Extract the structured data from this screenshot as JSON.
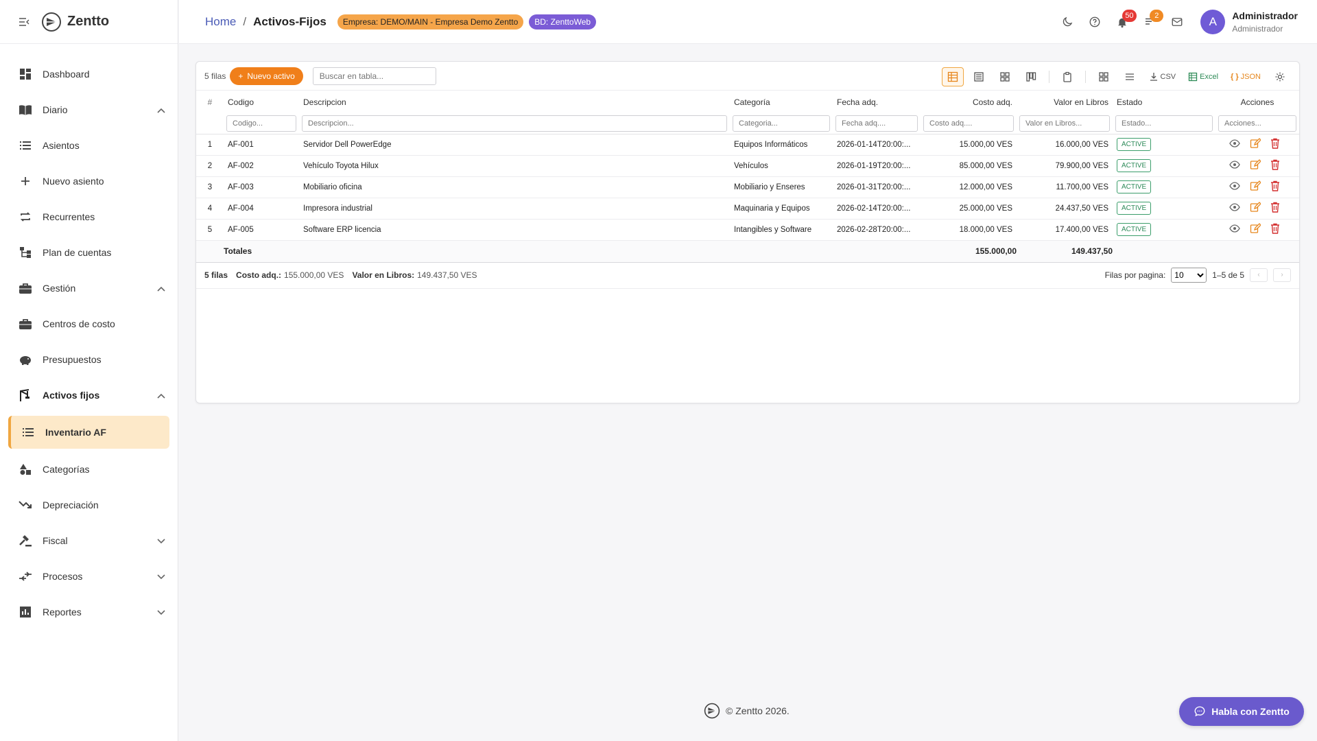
{
  "brand": {
    "name": "Zentto"
  },
  "sidebar": {
    "items": [
      {
        "label": "Dashboard",
        "icon": "dashboard-icon"
      },
      {
        "label": "Diario",
        "icon": "book-icon",
        "chevron": "up"
      },
      {
        "label": "Asientos",
        "icon": "list-icon"
      },
      {
        "label": "Nuevo asiento",
        "icon": "plus-icon"
      },
      {
        "label": "Recurrentes",
        "icon": "repeat-icon"
      },
      {
        "label": "Plan de cuentas",
        "icon": "tree-icon"
      },
      {
        "label": "Gestión",
        "icon": "briefcase-icon",
        "chevron": "up"
      },
      {
        "label": "Centros de costo",
        "icon": "briefcase-icon"
      },
      {
        "label": "Presupuestos",
        "icon": "piggy-bank-icon"
      },
      {
        "label": "Activos fijos",
        "icon": "crane-icon",
        "chevron": "up"
      },
      {
        "label": "Inventario AF",
        "icon": "list-icon",
        "active": true
      },
      {
        "label": "Categorías",
        "icon": "shapes-icon"
      },
      {
        "label": "Depreciación",
        "icon": "trending-down-icon"
      },
      {
        "label": "Fiscal",
        "icon": "gavel-icon",
        "chevron": "down"
      },
      {
        "label": "Procesos",
        "icon": "compare-arrows-icon",
        "chevron": "down"
      },
      {
        "label": "Reportes",
        "icon": "bar-chart-icon",
        "chevron": "down"
      }
    ]
  },
  "header": {
    "breadcrumb_home": "Home",
    "breadcrumb_sep": "/",
    "breadcrumb_current": "Activos-Fijos",
    "empresa_badge": "Empresa: DEMO/MAIN - Empresa Demo Zentto",
    "bd_badge": "BD: ZenttoWeb",
    "notifications_count": "50",
    "tasks_count": "2",
    "avatar_letter": "A",
    "user_name": "Administrador",
    "user_role": "Administrador"
  },
  "toolbar": {
    "rows_label": "5 filas",
    "new_button": "Nuevo activo",
    "search_placeholder": "Buscar en tabla...",
    "csv": "CSV",
    "excel": "Excel",
    "json": "JSON"
  },
  "table": {
    "columns": [
      "#",
      "Codigo",
      "Descripcion",
      "Categoría",
      "Fecha adq.",
      "Costo adq.",
      "Valor en Libros",
      "Estado",
      "Acciones"
    ],
    "filter_placeholders": [
      "Codigo...",
      "Descripcion...",
      "Categoria...",
      "Fecha adq....",
      "Costo adq....",
      "Valor en Libros...",
      "Estado...",
      "Acciones..."
    ],
    "rows": [
      {
        "n": "1",
        "codigo": "AF-001",
        "descripcion": "Servidor Dell PowerEdge",
        "categoria": "Equipos Informáticos",
        "fecha": "2026-01-14T20:00:...",
        "costo": "15.000,00 VES",
        "valor": "16.000,00 VES",
        "estado": "ACTIVE"
      },
      {
        "n": "2",
        "codigo": "AF-002",
        "descripcion": "Vehículo Toyota Hilux",
        "categoria": "Vehículos",
        "fecha": "2026-01-19T20:00:...",
        "costo": "85.000,00 VES",
        "valor": "79.900,00 VES",
        "estado": "ACTIVE"
      },
      {
        "n": "3",
        "codigo": "AF-003",
        "descripcion": "Mobiliario oficina",
        "categoria": "Mobiliario y Enseres",
        "fecha": "2026-01-31T20:00:...",
        "costo": "12.000,00 VES",
        "valor": "11.700,00 VES",
        "estado": "ACTIVE"
      },
      {
        "n": "4",
        "codigo": "AF-004",
        "descripcion": "Impresora industrial",
        "categoria": "Maquinaria y Equipos",
        "fecha": "2026-02-14T20:00:...",
        "costo": "25.000,00 VES",
        "valor": "24.437,50 VES",
        "estado": "ACTIVE"
      },
      {
        "n": "5",
        "codigo": "AF-005",
        "descripcion": "Software ERP licencia",
        "categoria": "Intangibles y Software",
        "fecha": "2026-02-28T20:00:...",
        "costo": "18.000,00 VES",
        "valor": "17.400,00 VES",
        "estado": "ACTIVE"
      }
    ],
    "totals_label": "Totales",
    "totals_costo": "155.000,00",
    "totals_valor": "149.437,50"
  },
  "summary": {
    "rows": "5 filas",
    "costo_label": "Costo adq.:",
    "costo_value": "155.000,00 VES",
    "valor_label": "Valor en Libros:",
    "valor_value": "149.437,50 VES"
  },
  "pager": {
    "label": "Filas por pagina:",
    "page_size": "10",
    "range": "1–5 de 5"
  },
  "footer": {
    "copyright": "© Zentto 2026."
  },
  "chat": {
    "label": "Habla con Zentto"
  },
  "colors": {
    "accent": "#f07f1a",
    "active_bg": "#fde9c9",
    "primary": "#6a5acd",
    "status": "#2d8a59"
  }
}
